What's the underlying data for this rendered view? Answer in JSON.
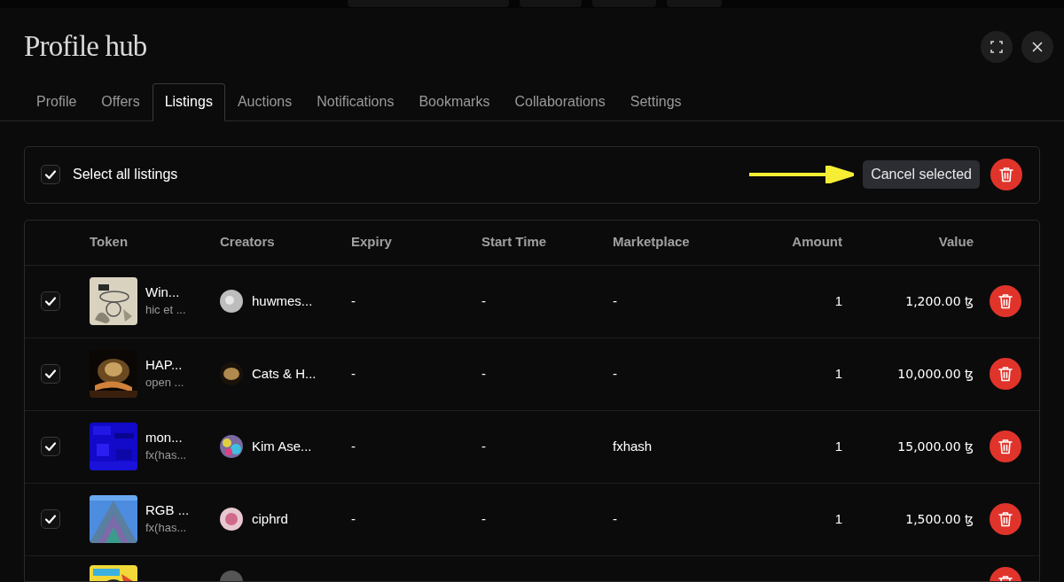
{
  "header": {
    "title": "Profile hub"
  },
  "tabs": [
    {
      "label": "Profile",
      "selected": false
    },
    {
      "label": "Offers",
      "selected": false
    },
    {
      "label": "Listings",
      "selected": true
    },
    {
      "label": "Auctions",
      "selected": false
    },
    {
      "label": "Notifications",
      "selected": false
    },
    {
      "label": "Bookmarks",
      "selected": false
    },
    {
      "label": "Collaborations",
      "selected": false
    },
    {
      "label": "Settings",
      "selected": false
    }
  ],
  "select_all": {
    "label": "Select all listings",
    "checked": true
  },
  "tooltip": {
    "text": "Cancel selected"
  },
  "table": {
    "columns": [
      "Token",
      "Creators",
      "Expiry",
      "Start Time",
      "Marketplace",
      "Amount",
      "Value"
    ],
    "rows": [
      {
        "kind": "full",
        "checked": true,
        "token": "Win...",
        "source": "hic et ...",
        "creator": "huwmes...",
        "expiry": "-",
        "start_time": "-",
        "marketplace": "-",
        "amount": "1",
        "value": "1,200.00 ꜩ"
      },
      {
        "kind": "full",
        "checked": true,
        "token": "HAP...",
        "source": "open ...",
        "creator": "Cats & H...",
        "expiry": "-",
        "start_time": "-",
        "marketplace": "-",
        "amount": "1",
        "value": "10,000.00 ꜩ"
      },
      {
        "kind": "full",
        "checked": true,
        "token": "mon...",
        "source": "fx(has...",
        "creator": "Kim Ase...",
        "expiry": "-",
        "start_time": "-",
        "marketplace": "fxhash",
        "amount": "1",
        "value": "15,000.00 ꜩ"
      },
      {
        "kind": "full",
        "checked": true,
        "token": "RGB ...",
        "source": "fx(has...",
        "creator": "ciphrd",
        "expiry": "-",
        "start_time": "-",
        "marketplace": "-",
        "amount": "1",
        "value": "1,500.00 ꜩ"
      },
      {
        "kind": "partial"
      }
    ]
  }
}
